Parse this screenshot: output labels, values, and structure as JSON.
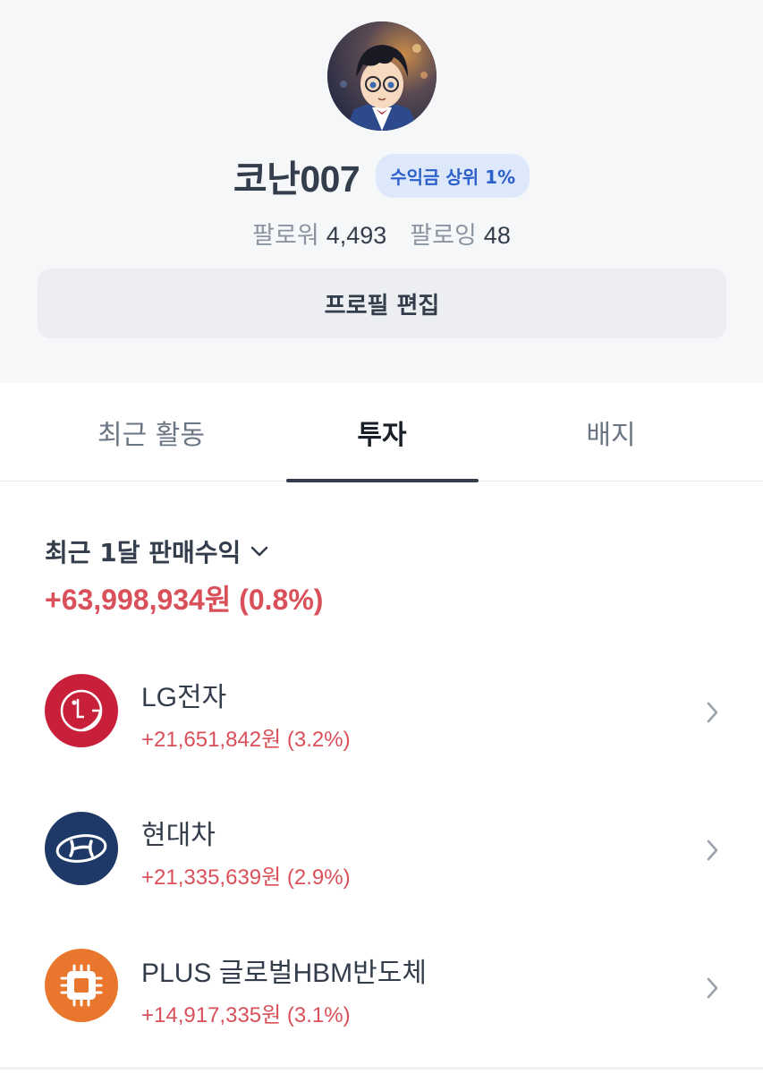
{
  "profile": {
    "username": "코난007",
    "badge": "수익금 상위 1%",
    "followers_label": "팔로워",
    "followers_count": "4,493",
    "following_label": "팔로잉",
    "following_count": "48",
    "edit_button": "프로필 편집"
  },
  "tabs": [
    {
      "label": "최근 활동",
      "active": false
    },
    {
      "label": "투자",
      "active": true
    },
    {
      "label": "배지",
      "active": false
    }
  ],
  "summary": {
    "label": "최근 1달 판매수익",
    "value": "+63,998,934원 (0.8%)"
  },
  "holdings": [
    {
      "name": "LG전자",
      "value": "+21,651,842원 (3.2%)",
      "icon": "lg-logo-icon",
      "color": "#c8203a"
    },
    {
      "name": "현대차",
      "value": "+21,335,639원 (2.9%)",
      "icon": "hyundai-logo-icon",
      "color": "#1e3867"
    },
    {
      "name": "PLUS 글로벌HBM반도체",
      "value": "+14,917,335원 (3.1%)",
      "icon": "chip-icon",
      "color": "#e8762c"
    }
  ],
  "colors": {
    "profit": "#d9505a",
    "badge_bg": "#dde8fb",
    "badge_text": "#2b5fc9"
  }
}
